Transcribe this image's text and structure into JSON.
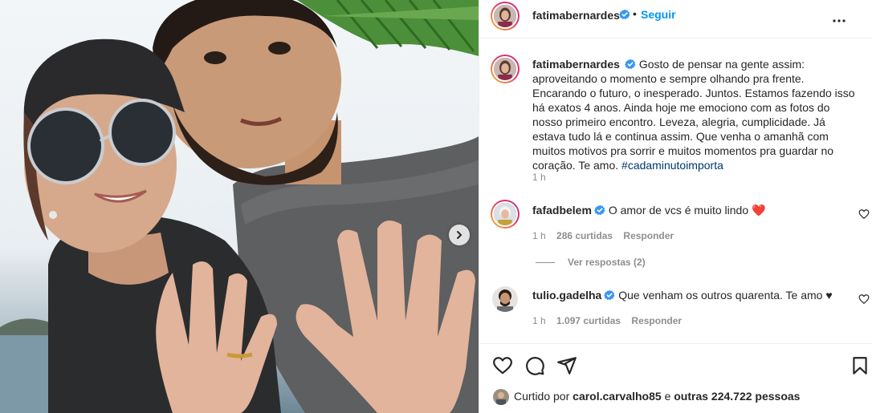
{
  "post": {
    "author": "fatimabernardes",
    "dot": "•",
    "follow_label": "Seguir"
  },
  "caption": {
    "author": "fatimabernardes",
    "text": "Gosto de pensar na gente assim: aproveitando o momento e sempre olhando pra frente. Encarando o futuro, o inesperado. Juntos. Estamos fazendo isso há exatos 4 anos. Ainda hoje me emociono com as fotos do nosso primeiro encontro. Leveza, alegria, cumplicidade. Já estava tudo lá e continua assim. Que venha o amanhã com muitos motivos pra sorrir e muitos momentos pra guardar no coração. Te amo.",
    "hashtag": "#cadaminutoimporta",
    "time": "1 h"
  },
  "comments": [
    {
      "author": "fafadbelem",
      "text": "O amor de vcs é muito lindo",
      "emoji": "❤️",
      "time": "1 h",
      "likes": "286 curtidas",
      "reply_label": "Responder"
    },
    {
      "author": "tulio.gadelha",
      "text": "Que venham os outros quarenta. Te amo ♥",
      "time": "1 h",
      "likes": "1.097 curtidas",
      "reply_label": "Responder"
    }
  ],
  "view_replies": "Ver respostas (2)",
  "likes_line": {
    "prefix": "Curtido por",
    "user": "carol.carvalho85",
    "middle": "e",
    "others": "outras 224.722 pessoas"
  },
  "icons": {
    "verified": "verified-badge-icon",
    "more": "more-horizontal-icon",
    "like": "heart-icon",
    "comment": "comment-bubble-icon",
    "share": "paper-plane-icon",
    "save": "bookmark-icon",
    "carousel_next": "chevron-right-icon"
  },
  "colors": {
    "link_blue": "#0095f6",
    "hashtag": "#00376b",
    "muted": "#8e8e8e",
    "verified": "#3897f0",
    "heart_red": "#ed4956"
  }
}
